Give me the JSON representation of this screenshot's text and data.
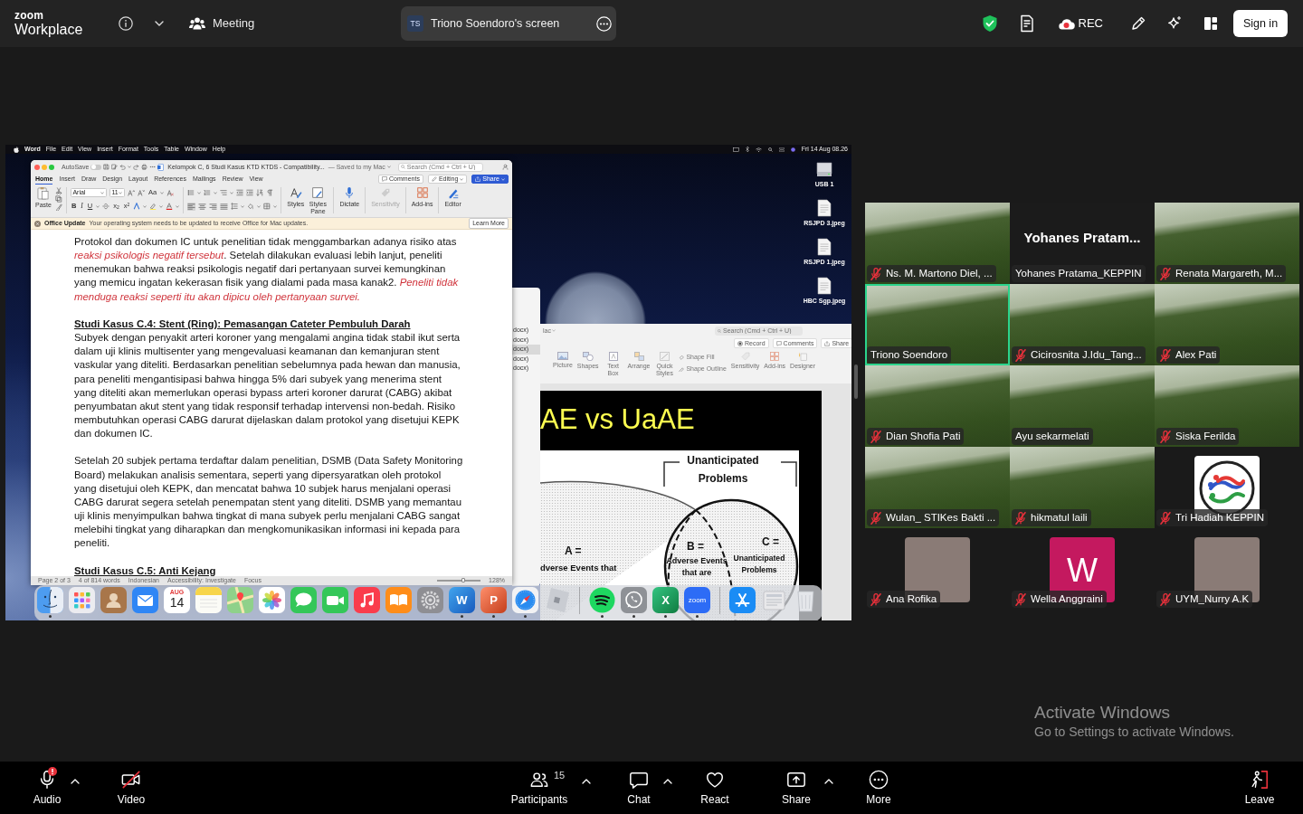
{
  "top_bar": {
    "brand": "zoom",
    "product": "Workplace",
    "meeting_button": "Meeting",
    "shared_screen_pill": {
      "initials": "TS",
      "title": "Triono Soendoro's screen"
    },
    "record_button": "REC",
    "sign_in_button": "Sign in"
  },
  "shared_screen": {
    "menu_bar": {
      "app_name": "Word",
      "menus": [
        "File",
        "Edit",
        "View",
        "Insert",
        "Format",
        "Tools",
        "Table",
        "Window",
        "Help"
      ],
      "clock": "Fri 14 Aug 08.26"
    },
    "desktop_icons": [
      {
        "kind": "drive",
        "label": "USB 1"
      },
      {
        "kind": "image",
        "label": "RSJPD 3.jpeg"
      },
      {
        "kind": "image",
        "label": "RSJPD 1.jpeg"
      },
      {
        "kind": "image",
        "label": "HBC Sgp.jpeg"
      }
    ],
    "finder_window": {
      "items": [
        {
          "label": "docx)",
          "selected": false
        },
        {
          "label": "docx)",
          "selected": false
        },
        {
          "label": "docx)",
          "selected": true
        },
        {
          "label": "docx)",
          "selected": false
        },
        {
          "label": "docx)",
          "selected": false
        }
      ]
    },
    "powerpoint_window": {
      "location": "lac",
      "search": {
        "placeholder": "Search (Cmd + Ctrl + U)"
      },
      "buttons": [
        {
          "kind": "record",
          "label": "Record"
        },
        {
          "kind": "comments",
          "label": "Comments"
        },
        {
          "kind": "share",
          "label": "Share"
        }
      ],
      "ribbon": [
        {
          "kind": "picture",
          "label": "Picture"
        },
        {
          "kind": "shapes",
          "label": "Shapes"
        },
        {
          "kind": "textbox",
          "label": "Text Box"
        },
        {
          "kind": "arrange",
          "label": "Arrange"
        },
        {
          "kind": "quickstyles",
          "label": "Quick Styles"
        },
        {
          "kind": "shapefill",
          "label": "Shape Fill"
        },
        {
          "kind": "shapeoutline",
          "label": "Shape Outline"
        },
        {
          "kind": "sensitivity",
          "label": "Sensitivity"
        },
        {
          "kind": "addins",
          "label": "Add-ins"
        },
        {
          "kind": "designer",
          "label": "Designer"
        }
      ],
      "slide": {
        "title": "AE vs UaAE",
        "diagram": {
          "bracket_label": "Unanticipated Problems",
          "labels": [
            {
              "kind": "a_head",
              "text": "A ="
            },
            {
              "kind": "a_text",
              "text": "dverse Events that"
            },
            {
              "kind": "b_head",
              "text": "B ="
            },
            {
              "kind": "b_text",
              "text": "Adverse Events that are"
            },
            {
              "kind": "c_head",
              "text": "C ="
            },
            {
              "kind": "c_text",
              "text": "Unanticipated Problems"
            }
          ]
        }
      }
    },
    "word_window": {
      "title_bar": {
        "autosave": {
          "label": "AutoSave",
          "on": false
        },
        "document_title": "Kelompok C, 6 Studi Kasus KTD KTDS - Compatibility...",
        "save_state": "— Saved to my Mac",
        "search": {
          "placeholder": "Search (Cmd + Ctrl + U)"
        }
      },
      "tabs": [
        {
          "label": "Home",
          "selected": true
        },
        {
          "label": "Insert",
          "selected": false
        },
        {
          "label": "Draw",
          "selected": false
        },
        {
          "label": "Design",
          "selected": false
        },
        {
          "label": "Layout",
          "selected": false
        },
        {
          "label": "References",
          "selected": false
        },
        {
          "label": "Mailings",
          "selected": false
        },
        {
          "label": "Review",
          "selected": false
        },
        {
          "label": "View",
          "selected": false
        }
      ],
      "comments_button": "Comments",
      "editing_button": "Editing",
      "share_button": "Share",
      "ribbon": {
        "paste": "Paste",
        "font_name": "Arial",
        "font_size": "11",
        "change_case": "Aa",
        "format_buttons": [
          {
            "kind": "bold",
            "text": "B"
          },
          {
            "kind": "italic",
            "text": "I"
          },
          {
            "kind": "underline",
            "text": "U"
          },
          {
            "kind": "subscript",
            "text": "x$_{2}$"
          },
          {
            "kind": "superscript",
            "text": "x$^{2}$"
          }
        ],
        "alignment": [
          {
            "kind": "left",
            "selected": true
          },
          {
            "kind": "center",
            "selected": false
          },
          {
            "kind": "right",
            "selected": false
          },
          {
            "kind": "justify",
            "selected": false
          }
        ],
        "commands": [
          {
            "kind": "styles",
            "label": "Styles",
            "disabled": false
          },
          {
            "kind": "styles_pane",
            "label": "Styles Pane",
            "disabled": false
          },
          {
            "kind": "dictate",
            "label": "Dictate",
            "disabled": false
          },
          {
            "kind": "sensitivity",
            "label": "Sensitivity",
            "disabled": true
          },
          {
            "kind": "addins",
            "label": "Add-ins",
            "disabled": false
          },
          {
            "kind": "editor",
            "label": "Editor",
            "disabled": false
          }
        ]
      },
      "update_banner": {
        "title": "Office Update",
        "message": "Your operating system needs to be updated to receive Office for Mac updates.",
        "button": "Learn More"
      },
      "document": [
        {
          "kind": "paragraph",
          "text": "Protokol dan dokumen IC untuk penelitian tidak menggambarkan adanya risiko atas *reaksi psikologis negatif tersebut*. Setelah dilakukan evaluasi lebih lanjut, peneliti menemukan bahwa reaksi psikologis negatif dari pertanyaan survei kemungkinan yang memicu ingatan kekerasan fisik yang dialami pada masa kanak2. *Peneliti tidak menduga reaksi seperti itu akan dipicu oleh pertanyaan survei.*"
        },
        {
          "kind": "heading",
          "text": "Studi Kasus C.4: Stent (Ring): Pemasangan Cateter Pembuluh Darah"
        },
        {
          "kind": "paragraph",
          "text": "Subyek dengan penyakit arteri koroner yang mengalami angina tidak stabil ikut serta dalam uji klinis multisenter yang mengevaluasi keamanan dan kemanjuran stent vaskular yang diteliti. Berdasarkan penelitian sebelumnya pada hewan dan manusia, para peneliti mengantisipasi bahwa hingga 5% dari subyek yang menerima stent yang diteliti akan memerlukan operasi bypass arteri koroner darurat (CABG) akibat penyumbatan akut stent yang tidak responsif terhadap intervensi non-bedah. Risiko membutuhkan operasi CABG darurat dijelaskan dalam protokol yang disetujui KEPK dan dokumen IC."
        },
        {
          "kind": "paragraph",
          "text": "Setelah 20 subjek pertama terdaftar dalam penelitian, DSMB (Data Safety Monitoring Board) melakukan analisis sementara, seperti yang dipersyaratkan oleh protokol yang disetujui oleh KEPK, dan mencatat bahwa 10 subjek harus menjalani operasi CABG darurat segera setelah penempatan stent yang diteliti. DSMB yang memantau uji klinis menyimpulkan bahwa tingkat di mana subyek perlu menjalani CABG sangat melebihi tingkat yang diharapkan dan mengkomunikasikan informasi ini kepada para peneliti."
        },
        {
          "kind": "heading",
          "text": "Studi Kasus C.5: Anti Kejang"
        }
      ],
      "status_bar": {
        "items": [
          "Page 2 of 3",
          "4 of 814 words",
          "Indonesian",
          "Accessibility: Investigate",
          "Focus"
        ],
        "zoom_slider": {
          "level": 0.6
        },
        "zoom": "128%"
      }
    },
    "dock": [
      [
        {
          "kind": "finder",
          "running": true
        },
        {
          "kind": "launchpad",
          "running": false
        },
        {
          "kind": "contacts",
          "running": false
        },
        {
          "kind": "mail",
          "running": false
        },
        {
          "kind": "calendar",
          "month": "AUG",
          "day": "14",
          "running": false
        },
        {
          "kind": "notes",
          "running": false
        },
        {
          "kind": "maps",
          "running": false
        },
        {
          "kind": "photos",
          "running": false
        },
        {
          "kind": "messages",
          "running": false
        },
        {
          "kind": "facetime",
          "running": false
        },
        {
          "kind": "music",
          "running": false
        },
        {
          "kind": "books",
          "running": false
        },
        {
          "kind": "settings",
          "running": false
        },
        {
          "kind": "word",
          "letter": "W",
          "running": true
        },
        {
          "kind": "powerpoint",
          "letter": "P",
          "running": true
        },
        {
          "kind": "safari",
          "running": true
        },
        {
          "kind": "game",
          "running": false
        }
      ],
      [
        {
          "kind": "spotify",
          "running": true
        },
        {
          "kind": "whatsapp",
          "running": true
        },
        {
          "kind": "excel",
          "letter": "X",
          "running": true
        },
        {
          "kind": "zoom",
          "letter": "zoom",
          "running": true
        }
      ],
      [
        {
          "kind": "appstore",
          "running": false
        },
        {
          "kind": "preview",
          "running": false
        },
        {
          "kind": "trash",
          "running": false
        }
      ]
    ]
  },
  "participants": [
    {
      "kind": "video",
      "name": "Ns. M. Martono Diel, ...",
      "muted": true,
      "speaking": false
    },
    {
      "kind": "name_only",
      "display_name": "Yohanes Pratam...",
      "name": "Yohanes Pratama_KEPPIN",
      "muted": false,
      "speaking": false
    },
    {
      "kind": "video",
      "name": "Renata Margareth, M...",
      "muted": true,
      "speaking": false
    },
    {
      "kind": "video",
      "name": "Triono Soendoro",
      "muted": false,
      "speaking": true
    },
    {
      "kind": "video",
      "name": "Cicirosnita J.Idu_Tang...",
      "muted": true,
      "speaking": false
    },
    {
      "kind": "video",
      "name": "Alex Pati",
      "muted": true,
      "speaking": false
    },
    {
      "kind": "video",
      "name": "Dian Shofia Pati",
      "muted": true,
      "speaking": false
    },
    {
      "kind": "video",
      "name": "Ayu sekarmelati",
      "muted": false,
      "speaking": false
    },
    {
      "kind": "video",
      "name": "Siska Ferilda",
      "muted": true,
      "speaking": false
    },
    {
      "kind": "video",
      "name": "Wulan_ STIKes Bakti ...",
      "muted": true,
      "speaking": false
    },
    {
      "kind": "video",
      "name": "hikmatul laili",
      "muted": true,
      "speaking": false
    },
    {
      "kind": "logo",
      "name": "Tri Hadiah KEPPIN",
      "muted": true,
      "speaking": false
    },
    {
      "kind": "photo",
      "name": "Ana Rofika",
      "muted": true,
      "speaking": false
    },
    {
      "kind": "letter",
      "letter": "W",
      "name": "Wella Anggraini",
      "muted": true,
      "speaking": false
    },
    {
      "kind": "photo",
      "name": "UYM_Nurry A.K",
      "muted": true,
      "speaking": false
    }
  ],
  "toolbar": {
    "items": [
      {
        "kind": "audio",
        "label": "Audio",
        "alert": true,
        "menu": true
      },
      {
        "kind": "video",
        "label": "Video",
        "off": true,
        "menu": false
      },
      {
        "kind": "participants",
        "label": "Participants",
        "count": "15",
        "menu": true
      },
      {
        "kind": "chat",
        "label": "Chat",
        "menu": true
      },
      {
        "kind": "react",
        "label": "React",
        "menu": false
      },
      {
        "kind": "share",
        "label": "Share",
        "menu": true
      },
      {
        "kind": "more",
        "label": "More",
        "menu": false
      },
      {
        "kind": "leave",
        "label": "Leave",
        "menu": false
      }
    ]
  },
  "os_notice": {
    "title": "Activate Windows",
    "message": "Go to Settings to activate Windows."
  }
}
